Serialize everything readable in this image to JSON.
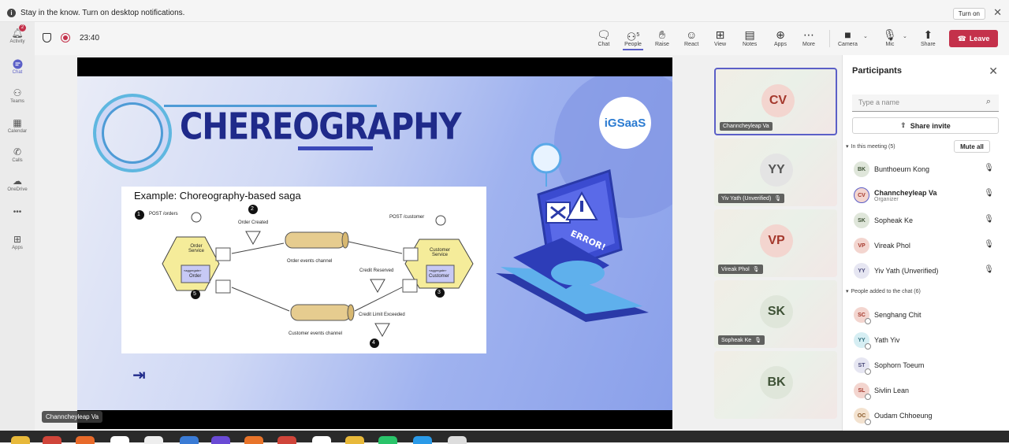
{
  "notification": {
    "text": "Stay in the know. Turn on desktop notifications.",
    "button": "Turn on",
    "close": "✕"
  },
  "rail": {
    "items": [
      {
        "label": "Activity",
        "icon": "bell-icon",
        "badge": "2"
      },
      {
        "label": "Chat",
        "icon": "chat-icon"
      },
      {
        "label": "Teams",
        "icon": "teams-icon"
      },
      {
        "label": "Calendar",
        "icon": "calendar-icon"
      },
      {
        "label": "Calls",
        "icon": "phone-icon"
      },
      {
        "label": "OneDrive",
        "icon": "cloud-icon"
      },
      {
        "label": "•••",
        "icon": "more-icon"
      },
      {
        "label": "Apps",
        "icon": "apps-icon"
      }
    ]
  },
  "toolbar": {
    "timer": "23:40",
    "people_count": "5",
    "buttons": [
      "Chat",
      "People",
      "Raise",
      "React",
      "View",
      "Notes",
      "Apps",
      "More",
      "Camera",
      "Mic",
      "Share"
    ],
    "leave": "Leave"
  },
  "slide": {
    "title": "CHEREOGRAPHY",
    "logo_text": "iGSaaS",
    "diagram": {
      "title": "Example: Choreography-based saga",
      "labels": {
        "post_orders": "POST /orders",
        "order_created": "Order Created",
        "post_customer": "POST /customer",
        "order_service": "Order Service",
        "order": "Order",
        "aggregate": "«aggregate»",
        "order_events": "Order events channel",
        "credit_reserved": "Credit Reserved",
        "customer_service": "Customer Service",
        "customer": "Customer",
        "credit_limit": "Credit Limit Exceeded",
        "customer_events": "Customer events channel",
        "n1": "1",
        "n2": "2",
        "n3": "3",
        "n4": "4",
        "n5": "5"
      }
    },
    "laptop_text": "ERROR!"
  },
  "share_label": "Channcheyleap Va",
  "tiles": [
    {
      "initials": "CV",
      "name": "Channcheyleap Va",
      "muted": false,
      "color": "#f3d5cf",
      "text_color": "#a4382c"
    },
    {
      "initials": "YY",
      "name": "Yiv Yath (Unverified)",
      "muted": true,
      "color": "#e4e4e4",
      "text_color": "#555555"
    },
    {
      "initials": "VP",
      "name": "Vireak Phol",
      "muted": true,
      "color": "#f3d5cf",
      "text_color": "#a4382c"
    },
    {
      "initials": "SK",
      "name": "Sopheak Ke",
      "muted": true,
      "color": "#dfe6da",
      "text_color": "#3e5236"
    },
    {
      "initials": "BK",
      "name": "",
      "muted": false,
      "color": "#dfe6da",
      "text_color": "#3e5236"
    }
  ],
  "panel": {
    "title": "Participants",
    "search_placeholder": "Type a name",
    "invite": "Share invite",
    "in_meeting": "In this meeting (5)",
    "mute_all": "Mute all",
    "in_meeting_list": [
      {
        "initials": "BK",
        "name": "Bunthoeurn Kong",
        "role": "",
        "mic": "on",
        "color": "#dfe6da",
        "text_color": "#3e5236"
      },
      {
        "initials": "CV",
        "name": "Channcheyleap Va",
        "role": "Organizer",
        "mic": "on",
        "color": "#f3d5cf",
        "text_color": "#a4382c"
      },
      {
        "initials": "SK",
        "name": "Sopheak Ke",
        "role": "",
        "mic": "off",
        "color": "#dfe6da",
        "text_color": "#3e5236"
      },
      {
        "initials": "VP",
        "name": "Vireak Phol",
        "role": "",
        "mic": "off",
        "color": "#f3d5cf",
        "text_color": "#a4382c"
      },
      {
        "initials": "YY",
        "name": "Yiv Yath (Unverified)",
        "role": "",
        "mic": "off",
        "color": "#e6e6f2",
        "text_color": "#4a4a7a"
      }
    ],
    "added": "People added to the chat (6)",
    "added_list": [
      {
        "initials": "SC",
        "name": "Senghang Chit",
        "color": "#f3d5cf",
        "text_color": "#a4382c"
      },
      {
        "initials": "YY",
        "name": "Yath Yiv",
        "color": "#d6eef3",
        "text_color": "#2d6b7a"
      },
      {
        "initials": "ST",
        "name": "Sophorn Toeum",
        "color": "#e6e6f2",
        "text_color": "#4a4a7a"
      },
      {
        "initials": "SL",
        "name": "Sivlin Lean",
        "color": "#f3d5cf",
        "text_color": "#a4382c"
      },
      {
        "initials": "OC",
        "name": "Oudam Chhoeung",
        "color": "#f3e2cf",
        "text_color": "#8a5a2a"
      }
    ]
  }
}
